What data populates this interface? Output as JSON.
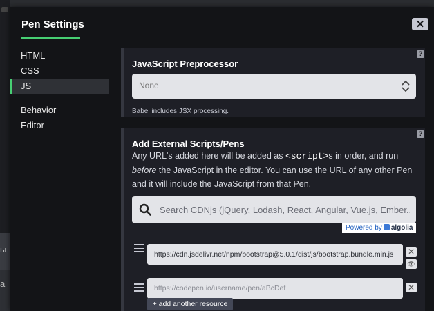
{
  "backdrop": {
    "peek_1": "ы",
    "peek_2": "а"
  },
  "modal": {
    "title": "Pen Settings",
    "close_glyph": "✕"
  },
  "sidebar": {
    "items": [
      {
        "label": "HTML",
        "active": false
      },
      {
        "label": "CSS",
        "active": false
      },
      {
        "label": "JS",
        "active": true
      },
      {
        "label": "Behavior",
        "active": false
      },
      {
        "label": "Editor",
        "active": false
      }
    ]
  },
  "preprocessor": {
    "title": "JavaScript Preprocessor",
    "help": "?",
    "selected": "None",
    "hint": "Babel includes JSX processing."
  },
  "external": {
    "title": "Add External Scripts/Pens",
    "help": "?",
    "desc_1": "Any URL's added here will be added as ",
    "desc_code": "<script>",
    "desc_2": "s in order, and run ",
    "desc_em": "before",
    "desc_3": " the JavaScript in the editor. You can use the URL of any other Pen and it will include the JavaScript from that Pen.",
    "search_placeholder": "Search CDNjs (jQuery, Lodash, React, Angular, Vue.js, Ember...",
    "powered_by": "Powered by",
    "algolia": "algolia",
    "resources": [
      {
        "value": "https://cdn.jsdelivr.net/npm/bootstrap@5.0.1/dist/js/bootstrap.bundle.min.js"
      },
      {
        "placeholder": "https://codepen.io/username/pen/aBcDef"
      }
    ],
    "remove_glyph": "✕",
    "view_glyph": "👁",
    "add_label": "+ add another resource"
  },
  "colors": {
    "accent": "#47cf73",
    "modal_bg": "#131417",
    "panel_bg": "#1e1f26",
    "field_bg": "#e3e4e8"
  }
}
